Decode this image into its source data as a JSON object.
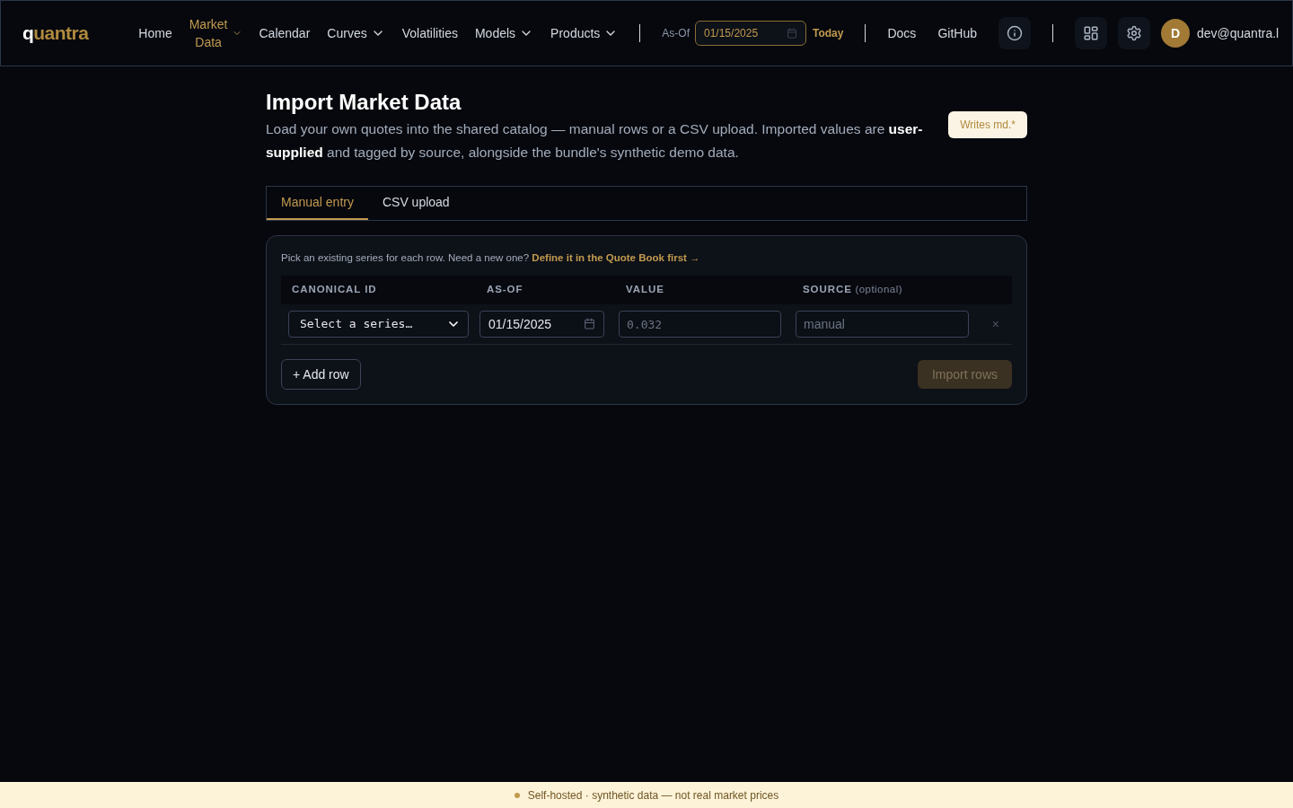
{
  "header": {
    "logo": {
      "lead": "q",
      "rest": "uantra"
    },
    "nav": [
      {
        "label": "Home",
        "selected": false,
        "dropdown": false
      },
      {
        "label": "Market Data",
        "selected": true,
        "dropdown": true
      },
      {
        "label": "Calendar",
        "selected": false,
        "dropdown": false
      },
      {
        "label": "Curves",
        "selected": false,
        "dropdown": true
      },
      {
        "label": "Volatilities",
        "selected": false,
        "dropdown": false
      },
      {
        "label": "Models",
        "selected": false,
        "dropdown": true
      },
      {
        "label": "Products",
        "selected": false,
        "dropdown": true
      }
    ],
    "as_of": {
      "label": "As-Of",
      "value": "01/15/2025"
    },
    "today_link": "Today",
    "links": [
      "Docs",
      "GitHub"
    ],
    "user": {
      "initial": "D",
      "email": "dev@quantra.l"
    }
  },
  "page": {
    "title": "Import Market Data",
    "description": "Load your own quotes into the shared catalog — manual rows or a CSV upload. Imported values are **user-supplied** and tagged by source, alongside the bundle's synthetic demo data.",
    "badge": "Writes md.*"
  },
  "tabs": [
    {
      "label": "Manual entry",
      "selected": true
    },
    {
      "label": "CSV upload",
      "selected": false
    }
  ],
  "form": {
    "hint": "Pick an existing series for each row. Need a new one?",
    "hint_link": "Define it in the Quote Book first →",
    "columns": [
      {
        "label": "CANONICAL ID"
      },
      {
        "label": "AS-OF"
      },
      {
        "label": "VALUE"
      },
      {
        "label": "SOURCE",
        "note": "(optional)"
      }
    ],
    "rows": [
      {
        "series": {
          "placeholder": "Select a series…"
        },
        "as_of": "01/15/2025",
        "value": {
          "placeholder": "0.032"
        },
        "source": {
          "placeholder": "manual"
        },
        "remove": "×"
      }
    ],
    "add_button": "+ Add row",
    "import_button": {
      "label": "Import rows",
      "disabled": true
    }
  },
  "footer_banner": "Self-hosted · synthetic data — not real market prices"
}
